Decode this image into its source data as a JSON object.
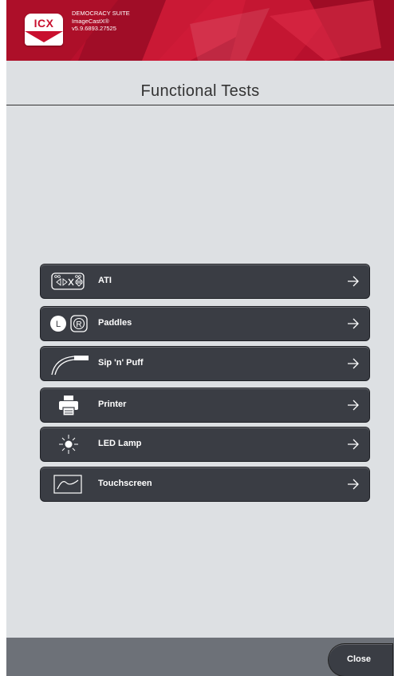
{
  "header": {
    "logo_text": "ICX",
    "brand_line1": "DEMOCRACY SUITE",
    "brand_line2": "ImageCastX®",
    "brand_line3": "v5.9.6893.27525"
  },
  "page": {
    "title": "Functional Tests"
  },
  "tests": [
    {
      "label": "ATI",
      "icon": "ati-keypad-icon"
    },
    {
      "label": "Paddles",
      "icon": "paddles-icon"
    },
    {
      "label": "Sip 'n' Puff",
      "icon": "sip-puff-icon"
    },
    {
      "label": "Printer",
      "icon": "printer-icon"
    },
    {
      "label": "LED Lamp",
      "icon": "led-lamp-icon"
    },
    {
      "label": "Touchscreen",
      "icon": "touchscreen-icon"
    }
  ],
  "footer": {
    "close_label": "Close"
  },
  "colors": {
    "header_red": "#b8102d",
    "button_dark": "#3a3d44",
    "background": "#dde0e3",
    "footer": "#6d7178"
  }
}
